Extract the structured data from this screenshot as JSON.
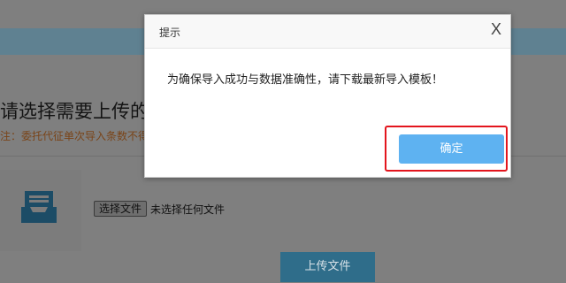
{
  "page": {
    "upload_title": "请选择需要上传的文",
    "upload_note": "注：委托代征单次导入条数不得超",
    "file_input": {
      "button_label": "选择文件",
      "status_text": "未选择任何文件"
    },
    "upload_button_label": "上传文件",
    "icon": "inbox-tray-icon"
  },
  "modal": {
    "title": "提示",
    "close_label": "X",
    "message": "为确保导入成功与数据准确性，请下载最新导入模板！",
    "confirm_label": "确定"
  },
  "colors": {
    "overlay_dim": "#7f7f7f",
    "confirm_button": "#5eb2f1",
    "highlight": "#e3151d",
    "upload_button": "#2f6d8a"
  }
}
